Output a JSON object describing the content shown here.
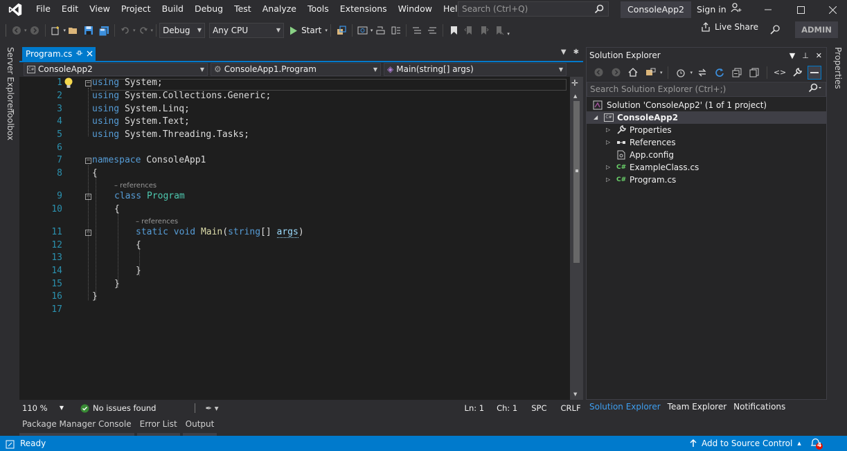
{
  "menu": [
    "File",
    "Edit",
    "View",
    "Project",
    "Build",
    "Debug",
    "Test",
    "Analyze",
    "Tools",
    "Extensions",
    "Window",
    "Help"
  ],
  "search": {
    "placeholder": "Search (Ctrl+Q)"
  },
  "solution_title": "ConsoleApp2",
  "sign_in": "Sign in",
  "toolbar": {
    "config": "Debug",
    "platform": "Any CPU",
    "start": "Start",
    "live_share": "Live Share",
    "admin": "ADMIN"
  },
  "side_tabs": {
    "left": [
      "Server Explorer",
      "Toolbox"
    ],
    "right": [
      "Properties"
    ]
  },
  "editor": {
    "tab_name": "Program.cs",
    "nav": {
      "project": "ConsoleApp2",
      "type": "ConsoleApp1.Program",
      "member": "Main(string[] args)"
    },
    "line_numbers": [
      "1",
      "2",
      "3",
      "4",
      "5",
      "6",
      "7",
      "8",
      "9",
      "10",
      "11",
      "12",
      "13",
      "14",
      "15",
      "16",
      "17"
    ],
    "code": [
      "using System;",
      "using System.Collections.Generic;",
      "using System.Linq;",
      "using System.Text;",
      "using System.Threading.Tasks;",
      "",
      "namespace ConsoleApp1",
      "{",
      "    class Program",
      "    {",
      "        static void Main(string[] args)",
      "        {",
      "",
      "        }",
      "    }",
      "}",
      ""
    ],
    "codelens": [
      "– references",
      "– references"
    ],
    "zoom": "110 %",
    "issues": "No issues found",
    "ln": "Ln: 1",
    "ch": "Ch: 1",
    "spc": "SPC",
    "crlf": "CRLF"
  },
  "solution_explorer": {
    "title": "Solution Explorer",
    "search_placeholder": "Search Solution Explorer (Ctrl+;)",
    "solution": "Solution 'ConsoleApp2' (1 of 1 project)",
    "project": "ConsoleApp2",
    "items": [
      "Properties",
      "References",
      "App.config",
      "ExampleClass.cs",
      "Program.cs"
    ],
    "tabs": [
      "Solution Explorer",
      "Team Explorer",
      "Notifications"
    ]
  },
  "bottom_tabs": [
    "Package Manager Console",
    "Error List",
    "Output"
  ],
  "status": {
    "ready": "Ready",
    "source_control": "Add to Source Control",
    "notifications_count": "4"
  },
  "colors": {
    "accent": "#007acc",
    "keyword": "#569cd6",
    "type": "#4ec9b0",
    "line_number": "#2b91af"
  }
}
